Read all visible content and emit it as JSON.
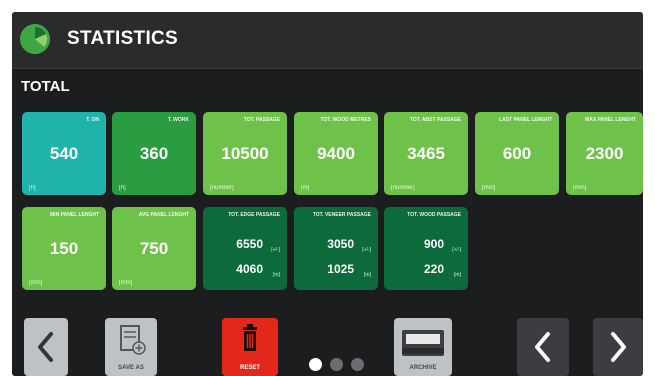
{
  "header": {
    "title": "STATISTICS",
    "logo_icon": "pie-logo-icon"
  },
  "section": {
    "title": "TOTAL"
  },
  "tiles": [
    {
      "label": "T. ON",
      "value": "540",
      "unit": "[h]",
      "color": "#1fb3ac"
    },
    {
      "label": "T. WORK",
      "value": "360",
      "unit": "[h]",
      "color": "#2a9c42"
    },
    {
      "label": "TOT. PASSAGE",
      "value": "10500",
      "unit": "[number]",
      "color": "#6ec24a"
    },
    {
      "label": "TOT. WOOD METRES",
      "value": "9400",
      "unit": "[m]",
      "color": "#6ec24a"
    },
    {
      "label": "TOT. ABST PASSAGE",
      "value": "3465",
      "unit": "[number]",
      "color": "#6ec24a"
    },
    {
      "label": "LAST PANEL LENGHT",
      "value": "600",
      "unit": "[mm]",
      "color": "#6ec24a"
    },
    {
      "label": "MAX PANEL LENGHT",
      "value": "2300",
      "unit": "[mm]",
      "color": "#6ec24a"
    },
    {
      "label": "MIN PANEL LENGHT",
      "value": "150",
      "unit": "[mm]",
      "color": "#6ec24a"
    },
    {
      "label": "AVG PANEL LENGHT",
      "value": "750",
      "unit": "[mm]",
      "color": "#6ec24a"
    }
  ],
  "dual_tiles": [
    {
      "label": "TOT. EDGE PASSAGE",
      "top_value": "6550",
      "top_unit": "[+/-]",
      "bottom_value": "4060",
      "bottom_unit": "[m]",
      "color": "#0d6a3d"
    },
    {
      "label": "TOT. VENEER PASSAGE",
      "top_value": "3050",
      "top_unit": "[+/-]",
      "bottom_value": "1025",
      "bottom_unit": "[m]",
      "color": "#0d6a3d"
    },
    {
      "label": "TOT. WOOD PASSAGE",
      "top_value": "900",
      "top_unit": "[+/-]",
      "bottom_value": "220",
      "bottom_unit": "[m]",
      "color": "#0d6a3d"
    }
  ],
  "footer": {
    "back_icon": "chevron-left-icon",
    "save_label": "SAVE AS",
    "save_icon": "save-file-icon",
    "reset_label": "RESET",
    "reset_icon": "trash-icon",
    "archive_label": "ARCHIVE",
    "archive_icon": "archive-tray-icon",
    "prev_icon": "chevron-left-icon",
    "next_icon": "chevron-right-icon",
    "pager": {
      "total": 3,
      "active": 1
    }
  }
}
